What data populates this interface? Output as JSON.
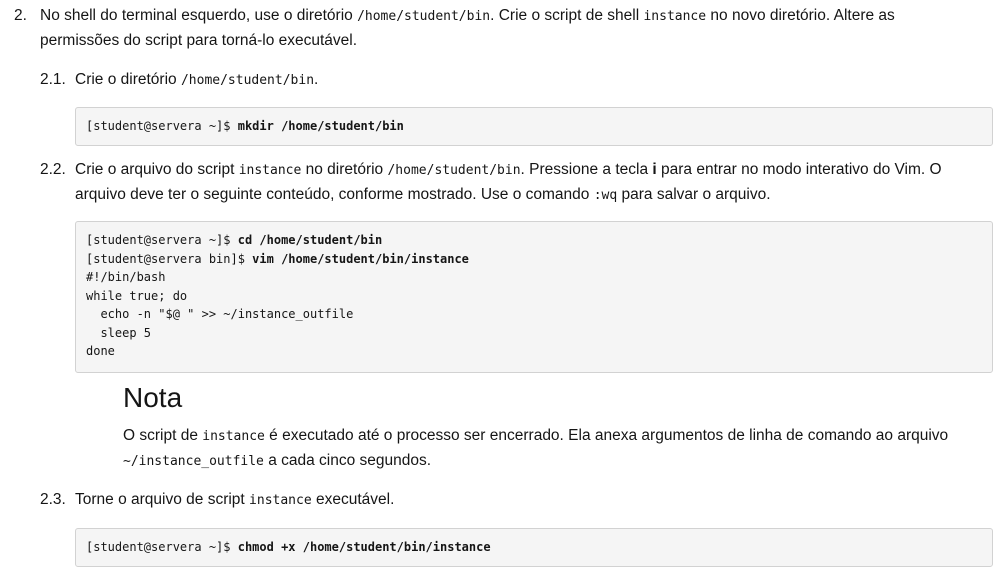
{
  "step2": {
    "number": "2.",
    "text_1": "No shell do terminal esquerdo, use o diretório ",
    "code_1": "/home/student/bin",
    "text_2": ". Crie o script de shell ",
    "code_2": "instance",
    "text_3": " no novo diretório. Altere as permissões do script para torná-lo executável."
  },
  "step21": {
    "number": "2.1.",
    "text_1": "Crie o diretório ",
    "code_1": "/home/student/bin",
    "text_2": ".",
    "code_prompt": "[student@servera ~]$ ",
    "code_cmd": "mkdir /home/student/bin"
  },
  "step22": {
    "number": "2.2.",
    "text_1": "Crie o arquivo do script ",
    "code_1": "instance",
    "text_2": " no diretório ",
    "code_2": "/home/student/bin",
    "text_3": ". Pressione a tecla ",
    "key": "i",
    "text_4": " para entrar no modo interativo do Vim. O arquivo deve ter o seguinte conteúdo, conforme mostrado. Use o comando ",
    "code_3": ":wq",
    "text_5": " para salvar o arquivo.",
    "line1_prompt": "[student@servera ~]$ ",
    "line1_cmd": "cd /home/student/bin",
    "line2_prompt": "[student@servera bin]$ ",
    "line2_cmd": "vim /home/student/bin/instance",
    "script_lines": "#!/bin/bash\nwhile true; do\n  echo -n \"$@ \" >> ~/instance_outfile\n  sleep 5\ndone"
  },
  "note": {
    "title": "Nota",
    "text_1": "O script de ",
    "code_1": "instance",
    "text_2": " é executado até o processo ser encerrado. Ela anexa argumentos de linha de comando ao arquivo ",
    "code_2": "~/instance_outfile",
    "text_3": " a cada cinco segundos."
  },
  "step23": {
    "number": "2.3.",
    "text_1": "Torne o arquivo de script ",
    "code_1": "instance",
    "text_2": " executável.",
    "code_prompt": "[student@servera ~]$ ",
    "code_cmd": "chmod +x /home/student/bin/instance"
  }
}
